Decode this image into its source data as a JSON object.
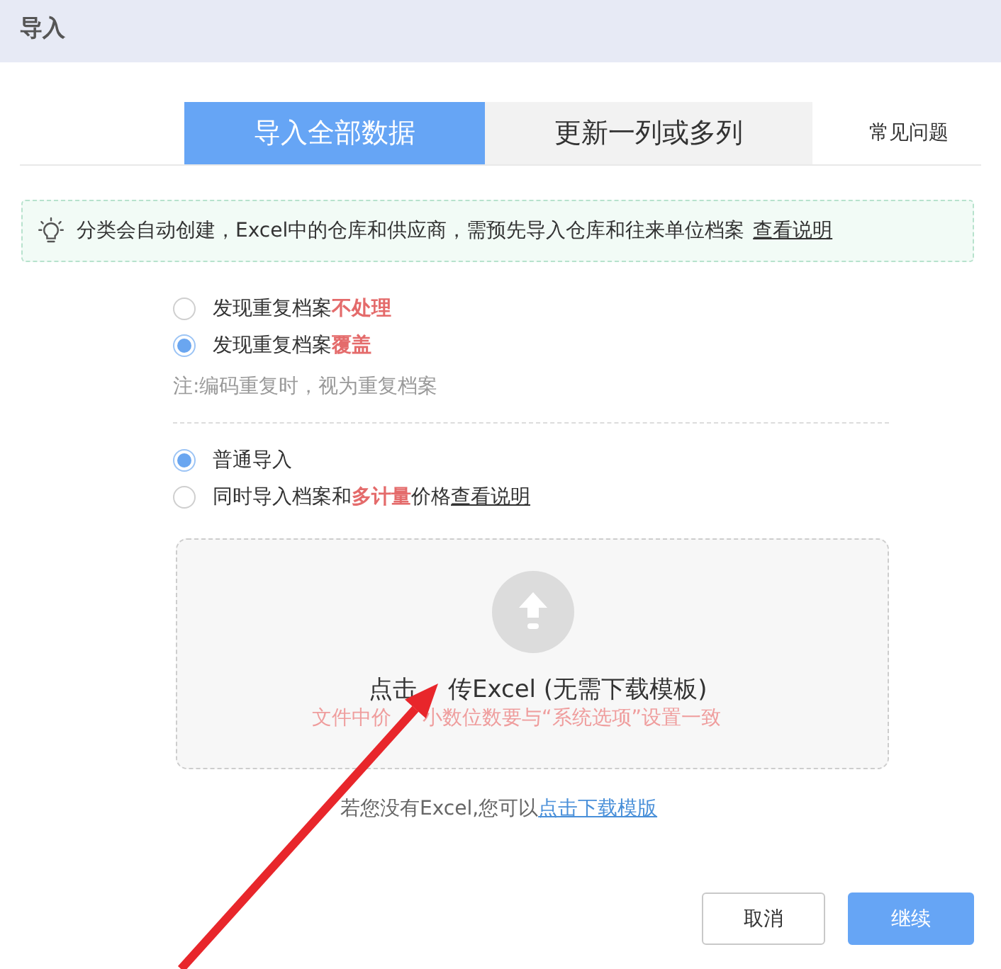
{
  "window": {
    "title": "导入"
  },
  "tabs": [
    {
      "label": "导入全部数据",
      "selected": true
    },
    {
      "label": "更新一列或多列",
      "selected": false
    }
  ],
  "help_link": "常见问题",
  "tip": {
    "text": "分类会自动创建，Excel中的仓库和供应商，需预先导入仓库和往来单位档案",
    "link": "查看说明"
  },
  "duplicate_options": [
    {
      "label": "发现重复档案**不处理**",
      "selected": false
    },
    {
      "label": "发现重复档案**覆盖**",
      "selected": true
    }
  ],
  "note": "注:编码重复时，视为重复档案",
  "import_modes": [
    {
      "label": "普通导入",
      "selected": true
    },
    {
      "label": "同时导入档案和**多计量**价格",
      "selected": false,
      "link": "查看说明"
    }
  ],
  "upload": {
    "title": [
      "点击",
      "传Excel (无需下载模板)"
    ],
    "hint": [
      "文件中价",
      "小数位数要与“系统选项”设置一致"
    ]
  },
  "download": {
    "text": "若您没有Excel,您可以",
    "link": "点击下载模版"
  },
  "buttons": [
    {
      "label": "取消",
      "kind": "secondary"
    },
    {
      "label": "继续",
      "kind": "primary"
    }
  ]
}
